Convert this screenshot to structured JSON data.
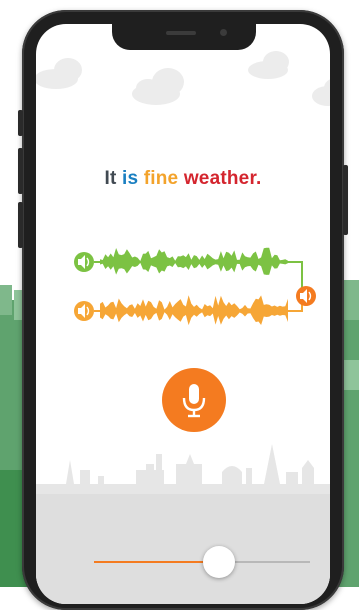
{
  "sentence": {
    "words": [
      "It",
      "is",
      "fine",
      "weather."
    ],
    "colors": [
      "#414a52",
      "#1a7fc1",
      "#f3a32b",
      "#d4252e"
    ]
  },
  "colors": {
    "native_wave": "#7cc243",
    "user_wave": "#f6a636",
    "mic": "#f47b20",
    "slider_fill": "#f47b20"
  },
  "icons": {
    "native_play": "speaker-icon",
    "user_play": "speaker-icon",
    "compare": "speaker-icon",
    "mic": "microphone-icon"
  },
  "slider": {
    "value": 0.58
  }
}
